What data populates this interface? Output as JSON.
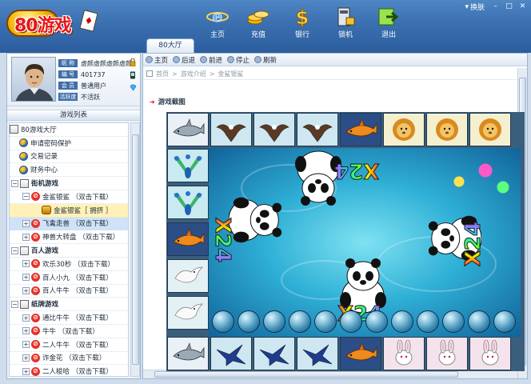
{
  "app": {
    "logo": "80游戏"
  },
  "header": {
    "nav": [
      {
        "label": "主页",
        "icon": "ie-icon"
      },
      {
        "label": "充值",
        "icon": "coins-icon"
      },
      {
        "label": "银行",
        "icon": "dollar-icon"
      },
      {
        "label": "锁机",
        "icon": "lock-computer-icon"
      },
      {
        "label": "退出",
        "icon": "exit-icon"
      }
    ],
    "switch_label": "换肤",
    "tab": "80大厅"
  },
  "user": {
    "nickname_key": "昵 称",
    "nickname": "虚颜虚颜虚颜虚颜",
    "id_key": "编 号",
    "id": "401737",
    "member_key": "会 员",
    "member": "普通用户",
    "social_key": "活跃度",
    "social": "不活跃"
  },
  "sidebar": {
    "title": "游戏列表",
    "items": [
      {
        "label": "80游戏大厅",
        "type": "root"
      },
      {
        "label": "申请密码保护",
        "type": "link"
      },
      {
        "label": "交易记录",
        "type": "link"
      },
      {
        "label": "财务中心",
        "type": "link"
      },
      {
        "label": "街机游戏",
        "type": "group"
      },
      {
        "label": "金鲨银鲨 （双击下载）",
        "type": "download"
      },
      {
        "label": "金鲨银鲨［ 拥挤 ］",
        "type": "room",
        "selected": true
      },
      {
        "label": "飞禽走兽 （双击下载）",
        "type": "download",
        "highlight": true
      },
      {
        "label": "神兽大转盘 （双击下载）",
        "type": "download"
      },
      {
        "label": "百人游戏",
        "type": "group"
      },
      {
        "label": "欢乐30秒 （双击下载）",
        "type": "download"
      },
      {
        "label": "百人小九 （双击下载）",
        "type": "download"
      },
      {
        "label": "百人牛牛 （双击下载）",
        "type": "download"
      },
      {
        "label": "纸牌游戏",
        "type": "group"
      },
      {
        "label": "通比牛牛 （双击下载）",
        "type": "download"
      },
      {
        "label": "牛牛 （双击下载）",
        "type": "download"
      },
      {
        "label": "二人牛牛 （双击下载）",
        "type": "download"
      },
      {
        "label": "诈金花 （双击下载）",
        "type": "download"
      },
      {
        "label": "二人梭哈 （双击下载）",
        "type": "download"
      }
    ]
  },
  "browser": {
    "toolbar": [
      "主页",
      "后退",
      "前进",
      "停止",
      "刷新"
    ],
    "crumbs": [
      "首页",
      ">",
      "游戏介绍",
      ">",
      "金鲨银鲨"
    ],
    "section_title": "游戏截图"
  },
  "game": {
    "multipliers": [
      "X24",
      "X24",
      "X24",
      "X24"
    ],
    "top_row": [
      "shark",
      "eagle",
      "eagle",
      "eagle",
      "gold-shark",
      "lion",
      "lion",
      "lion"
    ],
    "left_col": [
      "peacock",
      "peacock",
      "gold-shark",
      "dove",
      "dove"
    ],
    "bottom_row": [
      "shark",
      "swallow",
      "swallow",
      "swallow",
      "gold-shark",
      "rabbit",
      "rabbit",
      "rabbit"
    ],
    "colors": {
      "sea": "#2fb0d6",
      "header": "#3a6fb0"
    }
  }
}
